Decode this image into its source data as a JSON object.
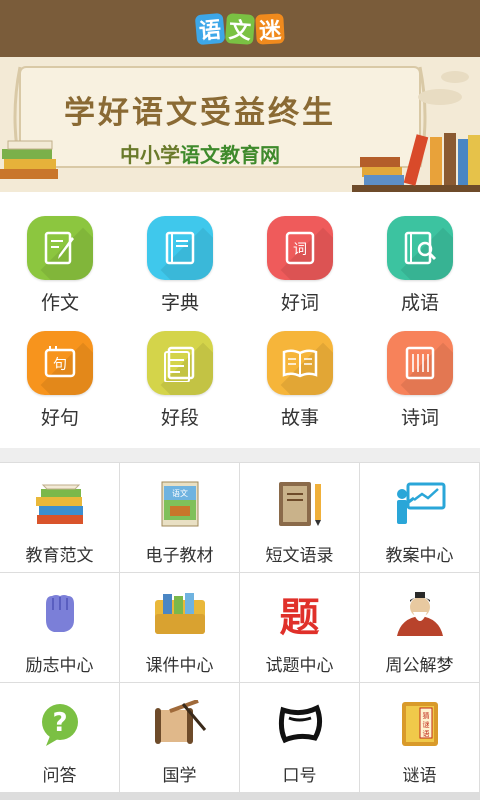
{
  "header": {
    "logo_chars": [
      {
        "char": "语",
        "color": "#3da7e8"
      },
      {
        "char": "文",
        "color": "#7ac143"
      },
      {
        "char": "迷",
        "color": "#f08a1d"
      }
    ]
  },
  "banner": {
    "title": "学好语文受益终生",
    "subtitle_part1": "中小学",
    "subtitle_part2": "语文教育网"
  },
  "top_grid": [
    {
      "label": "作文",
      "color": "#8cc63f",
      "icon": "compose-icon"
    },
    {
      "label": "字典",
      "color": "#3fc8ec",
      "icon": "dictionary-icon"
    },
    {
      "label": "好词",
      "color": "#ef5b5b",
      "icon": "word-book-icon"
    },
    {
      "label": "成语",
      "color": "#3cc3a0",
      "icon": "idiom-search-icon"
    },
    {
      "label": "好句",
      "color": "#f7941d",
      "icon": "sentence-icon"
    },
    {
      "label": "好段",
      "color": "#d4d44a",
      "icon": "paragraph-icon"
    },
    {
      "label": "故事",
      "color": "#f6b53a",
      "icon": "open-book-icon"
    },
    {
      "label": "诗词",
      "color": "#f7825a",
      "icon": "poetry-scroll-icon"
    }
  ],
  "bottom_grid": [
    {
      "label": "教育范文",
      "icon": "book-stack-icon"
    },
    {
      "label": "电子教材",
      "icon": "textbook-icon"
    },
    {
      "label": "短文语录",
      "icon": "notebook-pencil-icon"
    },
    {
      "label": "教案中心",
      "icon": "teacher-board-icon"
    },
    {
      "label": "励志中心",
      "icon": "fist-icon"
    },
    {
      "label": "课件中心",
      "icon": "folders-icon"
    },
    {
      "label": "试题中心",
      "icon": "exam-char-icon"
    },
    {
      "label": "周公解梦",
      "icon": "sage-portrait-icon"
    },
    {
      "label": "问答",
      "icon": "question-icon"
    },
    {
      "label": "国学",
      "icon": "scroll-brush-icon"
    },
    {
      "label": "口号",
      "icon": "megaphone-glyph-icon"
    },
    {
      "label": "谜语",
      "icon": "riddle-book-icon"
    }
  ],
  "exam_char": "题",
  "riddle_text": "猜谜语",
  "icon_glyphs": {
    "word": "词",
    "sentence": "句"
  }
}
